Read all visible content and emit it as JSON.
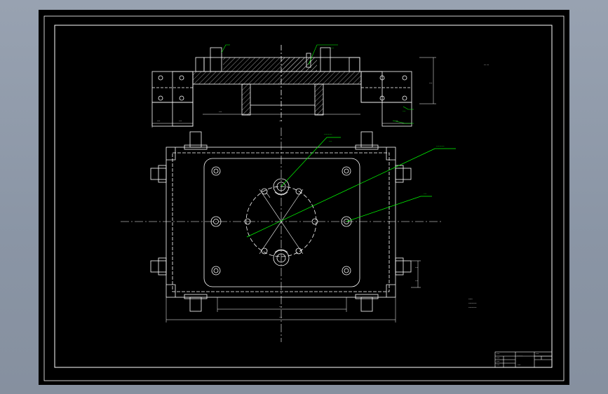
{
  "drawing": {
    "top_view": {
      "dimension_labels_left": [
        "---",
        "---"
      ],
      "dimension_labels_center": [
        "---",
        "---"
      ],
      "dimension_labels_right": [
        "---",
        "---"
      ],
      "leader_note": "---",
      "leader_note_2": "---"
    },
    "plan_view": {
      "callout_1": "--------",
      "callout_1_sub": "---",
      "callout_2": "--------",
      "callout_3": "---",
      "width_dim": "---",
      "overall_dim": "---",
      "side_dims": [
        "---",
        "---"
      ]
    },
    "notes": {
      "title_mark": "-- --",
      "tech_requirements_title": "----",
      "tech_requirements_lines": [
        "--------",
        "--------"
      ]
    },
    "title_block": {
      "drawing_name": "- - -",
      "cells": [
        "---",
        "---",
        "---",
        "---",
        "---",
        "---"
      ]
    }
  },
  "colors": {
    "background": "#000000",
    "line": "#ffffff",
    "annotation": "#00ff00",
    "frame_outer": "#8d98a8"
  }
}
